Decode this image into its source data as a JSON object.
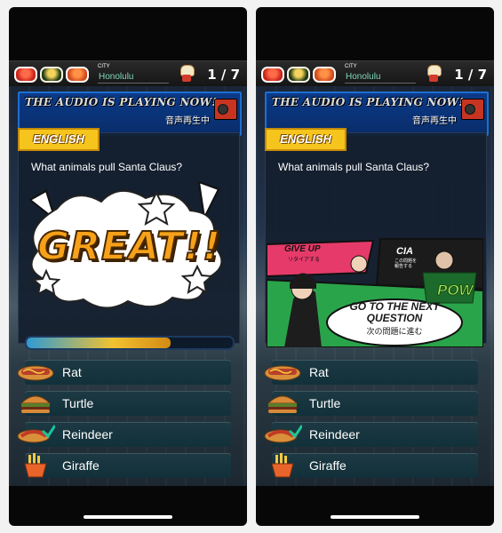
{
  "header": {
    "city_label": "CITY",
    "city_name": "Honolulu",
    "counter": "1 / 7",
    "icons": [
      "sushi-icon",
      "sushi-icon",
      "sushi-icon",
      "lucky-cat-icon"
    ]
  },
  "banner": {
    "title": "THE AUDIO IS PLAYING NOW!",
    "subtitle": "音声再生中"
  },
  "language": "ENGLISH",
  "question": "What animals pull Santa Claus?",
  "feedback": "GREAT!!",
  "progress": 0.7,
  "answers": [
    {
      "label": "Rat",
      "icon": "hotdog-icon"
    },
    {
      "label": "Turtle",
      "icon": "burger-icon"
    },
    {
      "label": "Reindeer",
      "icon": "sausage-icon"
    },
    {
      "label": "Giraffe",
      "icon": "fries-icon"
    }
  ],
  "menu": {
    "give_up": "GIVE UP",
    "give_up_jp": "リタイアする",
    "cia": "CIA",
    "cia_jp": "この問題を 報告する",
    "next": "GO TO THE NEXT QUESTION",
    "next_jp": "次の問題に進む",
    "pow": "POW"
  },
  "colors": {
    "accent": "#f6c51d",
    "city": "#7ed9b7",
    "banner": "#0b3a88"
  }
}
